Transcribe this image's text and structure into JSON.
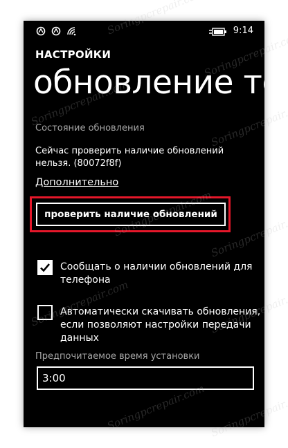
{
  "status_bar": {
    "time": "9:14",
    "icons": [
      "notification-icon",
      "notification-icon",
      "wifi-icon",
      "battery-charging-icon"
    ]
  },
  "header": {
    "app_name": "НАСТРОЙКИ",
    "title": "обновление телефона"
  },
  "update_status": {
    "label": "Состояние обновления",
    "message": "Сейчас проверить наличие обновлений нельзя. (80072f8f)",
    "more_link": "Дополнительно"
  },
  "check_button": {
    "label": "проверить наличие обновлений"
  },
  "options": [
    {
      "label": "Сообщать о наличии обновлений для телефона",
      "checked": true
    },
    {
      "label": "Автоматически скачивать обновления, если позволяют настройки передачи данных",
      "checked": false
    }
  ],
  "install_time": {
    "label": "Предпочитаемое время установки",
    "value": "3:00"
  },
  "watermark": "Soringpcrepair.com",
  "colors": {
    "background": "#000000",
    "text": "#ffffff",
    "secondary_text": "#a6a6a6",
    "highlight": "#e5172a"
  }
}
